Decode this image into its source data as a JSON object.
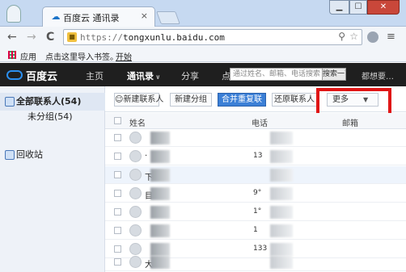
{
  "browser": {
    "tab_title": "百度云 通讯录",
    "tab_close": "×",
    "url_scheme": "https://",
    "url_host": "tongxunlu.baidu.com",
    "nav_back": "←",
    "nav_forward": "→",
    "nav_reload": "C",
    "zoom_glyph": "⚲",
    "star_glyph": "☆",
    "menu_glyph": "≡",
    "win_min": "▁",
    "win_max": "☐",
    "win_close": "✕"
  },
  "bookmarks": {
    "apps": "应用",
    "import_hint": "点击这里导入书签。",
    "start": "开始"
  },
  "baidu": {
    "logo_text": "百度云",
    "nav": [
      "主页",
      "通讯录",
      "分享",
      "点"
    ],
    "search_placeholder": "通过姓名、邮箱、电话搜索",
    "search_button": "搜索一下",
    "want_more": "都想要…"
  },
  "sidebar": {
    "items": [
      {
        "label": "全部联系人(54)"
      },
      {
        "label": "未分组(54)"
      },
      {
        "label": "回收站"
      }
    ]
  },
  "actions": {
    "new_contact": "新建联系人",
    "new_group": "新建分组",
    "merge_dupes": "合并重复联",
    "restore": "还原联系人",
    "more": "更多"
  },
  "table": {
    "headers": [
      "姓名",
      "电话",
      "邮箱"
    ],
    "rows": [
      {
        "name": "",
        "phone": ""
      },
      {
        "name": "·",
        "phone": "13"
      },
      {
        "name": "下",
        "phone": ""
      },
      {
        "name": "目",
        "phone": "9°"
      },
      {
        "name": "",
        "phone": "1°"
      },
      {
        "name": "",
        "phone": "1"
      },
      {
        "name": "",
        "phone": "133"
      },
      {
        "name": "大",
        "phone": ""
      }
    ]
  },
  "colors": {
    "baidu_blue": "#2b8ff0",
    "header_bg": "#1f1f1f",
    "highlight_red": "#e01616",
    "primary_button": "#3b7fd6"
  }
}
